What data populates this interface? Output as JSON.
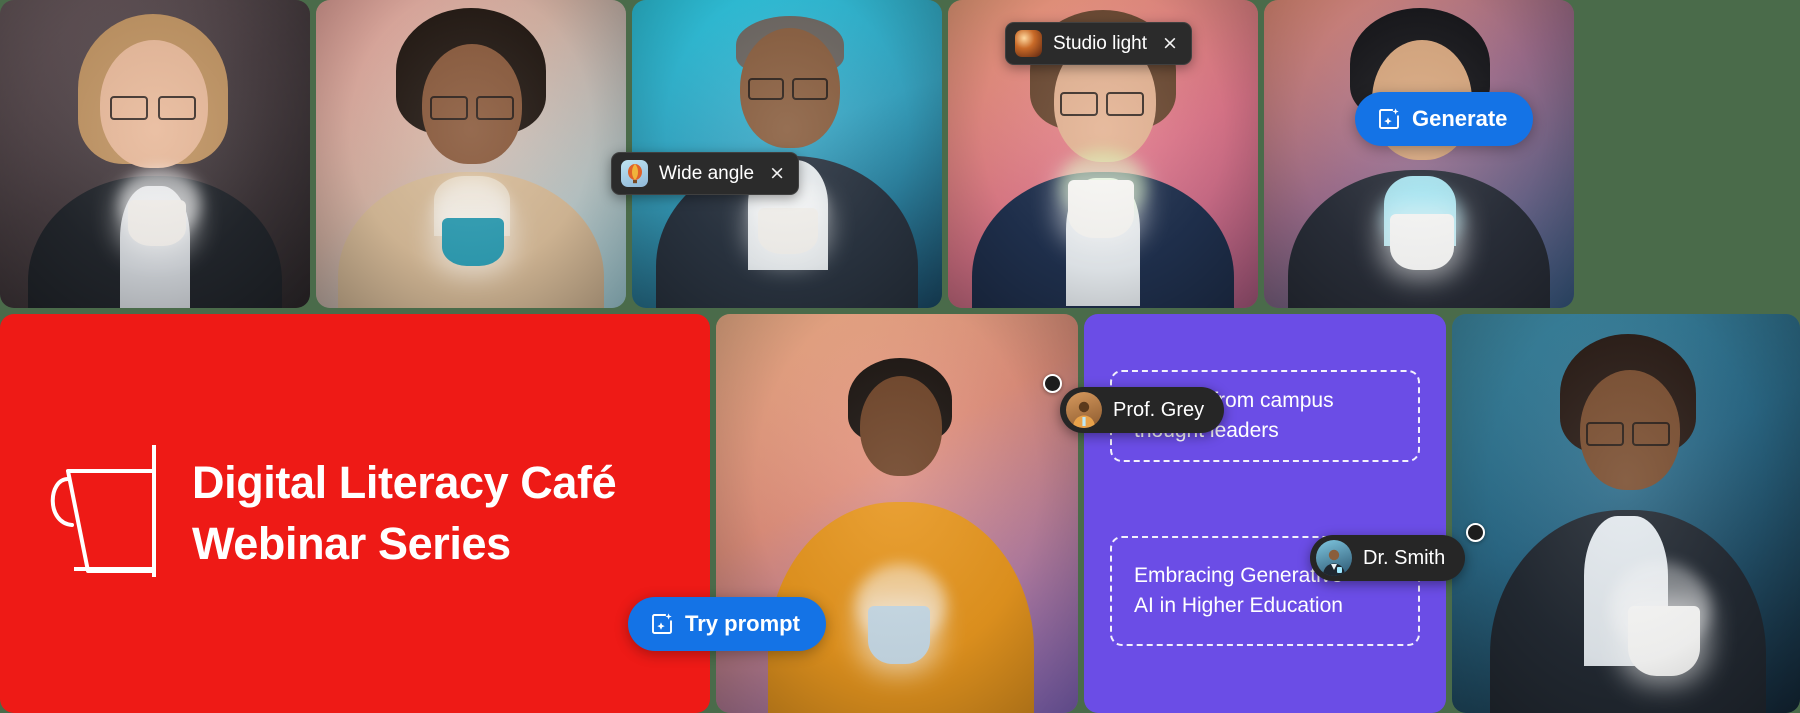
{
  "app": {
    "background_color": "#4a6b4a",
    "accent_blue": "#1473e6",
    "brand_red": "#ee1a16",
    "purple": "#6b4de6"
  },
  "brand_card": {
    "title": "Digital Literacy Café\nWebinar Series",
    "logo_icon": "coffee-cup-logo",
    "background_color": "#ee1a16"
  },
  "chips": [
    {
      "label": "Wide angle",
      "thumb_icon": "hot-air-balloon-thumbnail",
      "close_label": "×"
    },
    {
      "label": "Studio light",
      "thumb_icon": "glossy-sphere-thumbnail",
      "close_label": "×"
    }
  ],
  "buttons": [
    {
      "label": "Generate",
      "icon": "generate-sparkle-icon",
      "color": "#1473e6"
    },
    {
      "label": "Try prompt",
      "icon": "generate-sparkle-icon",
      "color": "#1473e6"
    }
  ],
  "collaborators": [
    {
      "name": "Prof. Grey",
      "avatar_icon": "user-avatar-prof-grey"
    },
    {
      "name": "Dr. Smith",
      "avatar_icon": "user-avatar-dr-smith"
    }
  ],
  "prompt_cards": [
    {
      "text": "Insights from campus\nthought leaders"
    },
    {
      "text": "Embracing Generative\nAI in Higher Education"
    }
  ],
  "image_tiles": [
    {
      "alt": "Woman with glasses holding a glowing cup",
      "skin": "#e8b99a",
      "hair": "#b98c5e",
      "bg_a": "#5b4f52",
      "bg_b": "#3a3033",
      "outfit": "#22262c"
    },
    {
      "alt": "Man with afro and glasses holding a teal cup",
      "skin": "#8a5a3c",
      "hair": "#241a14",
      "bg_a": "#e8a8a0",
      "bg_b": "#b7dfe6",
      "outfit": "#d9bd9a"
    },
    {
      "alt": "Smiling man in vest holding a cup and saucer",
      "skin": "#8a5f40",
      "hair": "#d8d2cc",
      "bg_a": "#1fc6e0",
      "bg_b": "#2a7f9e",
      "outfit": "#2b3542"
    },
    {
      "alt": "Woman in blazer holding a white mug",
      "skin": "#e4b393",
      "hair": "#6c4a33",
      "bg_a": "#e88a6a",
      "bg_b": "#c96a86",
      "outfit": "#20314f"
    },
    {
      "alt": "Person with glasses holding a glowing white mug",
      "skin": "#d8a77e",
      "hair": "#1a1a1e",
      "bg_a": "#e7907a",
      "bg_b": "#3a5f8a",
      "outfit": "#2a2f3a"
    },
    {
      "alt": "Man in orange sweater holding a blue mug",
      "skin": "#6e4327",
      "hair": "#1b1410",
      "bg_a": "#f0a27c",
      "bg_b": "#7d63c4",
      "outfit": "#e8971f"
    },
    {
      "alt": "Woman with glasses holding a white mug",
      "skin": "#7a4e30",
      "hair": "#2a1c16",
      "bg_a": "#2f7f9a",
      "bg_b": "#1d3a52",
      "outfit": "#232a33"
    }
  ]
}
